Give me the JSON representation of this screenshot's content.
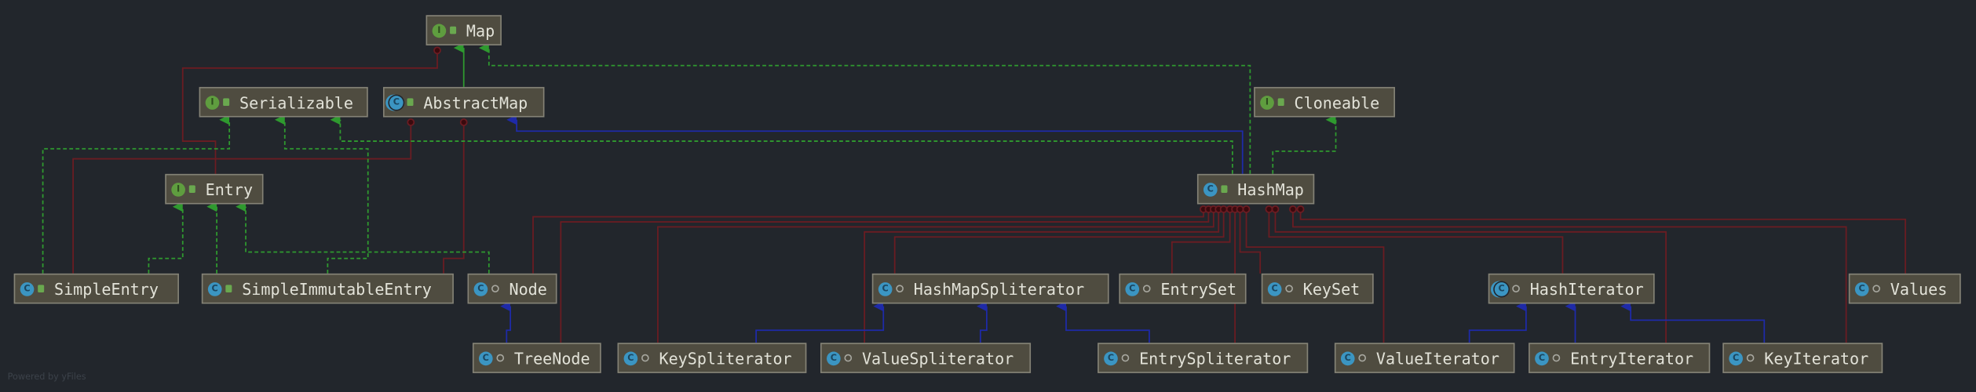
{
  "diagram": {
    "credit": "Powered by yFiles",
    "colors": {
      "background": "#22262c",
      "node_fill": "#4f4c40",
      "inner_class_edge": "#6b1c22",
      "implements_edge": "#2f9a2f",
      "extends_interface_edge": "#2f9a2f",
      "extends_class_edge": "#1e2aa8"
    },
    "nodes": [
      {
        "label": "Map",
        "kind": "interface",
        "icon": "I",
        "visibility": "public"
      },
      {
        "label": "Serializable",
        "kind": "interface",
        "icon": "I",
        "visibility": "public"
      },
      {
        "label": "AbstractMap",
        "kind": "abstract-class",
        "icon": "C",
        "visibility": "public"
      },
      {
        "label": "Cloneable",
        "kind": "interface",
        "icon": "I",
        "visibility": "public"
      },
      {
        "label": "Entry",
        "kind": "interface",
        "icon": "I",
        "visibility": "public"
      },
      {
        "label": "HashMap",
        "kind": "class",
        "icon": "C",
        "visibility": "public"
      },
      {
        "label": "SimpleEntry",
        "kind": "class",
        "icon": "C",
        "visibility": "public"
      },
      {
        "label": "SimpleImmutableEntry",
        "kind": "class",
        "icon": "C",
        "visibility": "public"
      },
      {
        "label": "Node",
        "kind": "class",
        "icon": "C",
        "visibility": "package"
      },
      {
        "label": "HashMapSpliterator",
        "kind": "class",
        "icon": "C",
        "visibility": "package"
      },
      {
        "label": "EntrySet",
        "kind": "class",
        "icon": "C",
        "visibility": "package"
      },
      {
        "label": "KeySet",
        "kind": "class",
        "icon": "C",
        "visibility": "package"
      },
      {
        "label": "HashIterator",
        "kind": "abstract-class",
        "icon": "C",
        "visibility": "package"
      },
      {
        "label": "Values",
        "kind": "class",
        "icon": "C",
        "visibility": "package"
      },
      {
        "label": "TreeNode",
        "kind": "class",
        "icon": "C",
        "visibility": "package"
      },
      {
        "label": "KeySpliterator",
        "kind": "class",
        "icon": "C",
        "visibility": "package"
      },
      {
        "label": "ValueSpliterator",
        "kind": "class",
        "icon": "C",
        "visibility": "package"
      },
      {
        "label": "EntrySpliterator",
        "kind": "class",
        "icon": "C",
        "visibility": "package"
      },
      {
        "label": "ValueIterator",
        "kind": "class",
        "icon": "C",
        "visibility": "package"
      },
      {
        "label": "EntryIterator",
        "kind": "class",
        "icon": "C",
        "visibility": "package"
      },
      {
        "label": "KeyIterator",
        "kind": "class",
        "icon": "C",
        "visibility": "package"
      }
    ]
  }
}
